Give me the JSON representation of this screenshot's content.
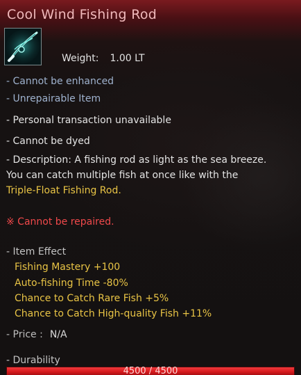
{
  "item": {
    "name": "Cool Wind Fishing Rod",
    "icon": "fishing-rod-icon",
    "weight_label": "Weight:",
    "weight_value": "1.00 LT"
  },
  "properties": {
    "enhance": "- Cannot be enhanced",
    "repair_item": "- Unrepairable Item",
    "transaction": "- Personal transaction unavailable",
    "dye": "- Cannot be dyed"
  },
  "description": {
    "line1": "- Description: A fishing rod as light as the sea breeze.",
    "line2": "You can catch multiple fish at once like with the",
    "line3": "Triple-Float Fishing Rod."
  },
  "warning": "※ Cannot be repaired.",
  "item_effect": {
    "header": "- Item Effect",
    "effects": [
      "Fishing Mastery +100",
      "Auto-fishing Time -80%",
      "Chance to Catch Rare Fish +5%",
      "Chance to Catch High-quality Fish +11%"
    ]
  },
  "price": {
    "label": "- Price :",
    "value": "N/A"
  },
  "durability": {
    "label": "- Durability",
    "text": "4500 / 4500",
    "current": 4500,
    "max": 4500
  },
  "colors": {
    "title": "#f0b9bb",
    "property_blue": "#9fb2ce",
    "effect_yellow": "#e9c445",
    "warning_red": "#f0494b",
    "durability_bar": "#d4191c"
  }
}
